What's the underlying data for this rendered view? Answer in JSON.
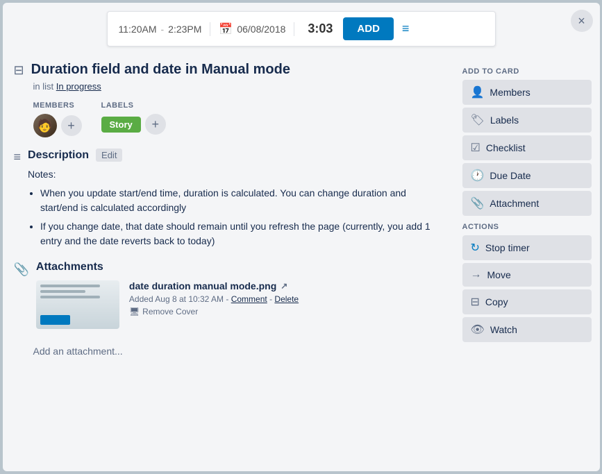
{
  "modal": {
    "close_label": "×"
  },
  "timer": {
    "start_time": "11:20AM",
    "separator": "-",
    "end_time": "2:23PM",
    "date": "06/08/2018",
    "duration": "3:03",
    "add_label": "ADD"
  },
  "card": {
    "title": "Duration field and date in Manual mode",
    "in_list_prefix": "in list",
    "list_name": "In progress",
    "members_label": "MEMBERS",
    "labels_label": "LABELS",
    "label_badge": "Story",
    "description_heading": "Description",
    "description_edit": "Edit",
    "description_notes": "Notes:",
    "description_items": [
      "When you update start/end time, duration is calculated. You can change duration and start/end is calculated accordingly",
      "If you change date, that date should remain until you refresh the page (currently, you add 1 entry and the date reverts back to today)"
    ],
    "attachments_heading": "Attachments",
    "attachment": {
      "name": "date duration manual mode.png",
      "added": "Added Aug 8 at 10:32 AM",
      "comment_label": "Comment",
      "delete_label": "Delete",
      "remove_cover_label": "Remove Cover"
    },
    "add_attachment_label": "Add an attachment..."
  },
  "sidebar": {
    "add_to_card_title": "ADD TO CARD",
    "actions_title": "ACTIONS",
    "buttons": [
      {
        "icon": "👤",
        "label": "Members"
      },
      {
        "icon": "🏷",
        "label": "Labels"
      },
      {
        "icon": "☑",
        "label": "Checklist"
      },
      {
        "icon": "🕐",
        "label": "Due Date"
      },
      {
        "icon": "📎",
        "label": "Attachment"
      }
    ],
    "action_buttons": [
      {
        "icon": "↻",
        "label": "Stop timer",
        "type": "stop"
      },
      {
        "icon": "→",
        "label": "Move"
      },
      {
        "icon": "⊟",
        "label": "Copy"
      },
      {
        "icon": "👁",
        "label": "Watch"
      }
    ]
  }
}
